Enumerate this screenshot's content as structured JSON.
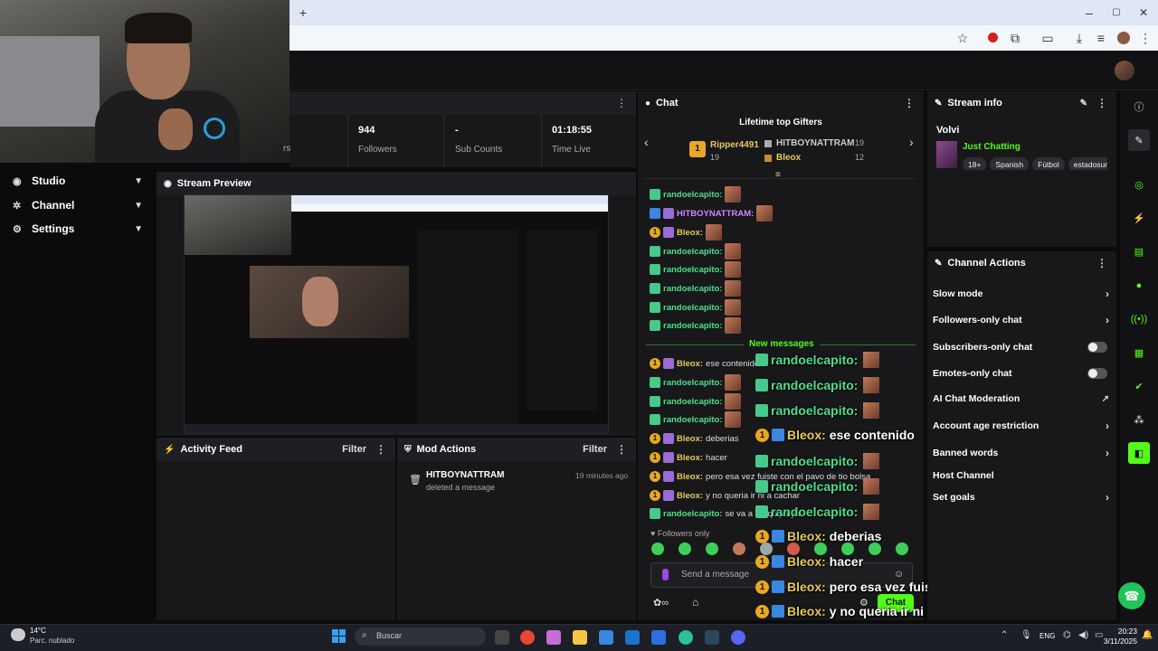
{
  "browser": {
    "new_tab": "+",
    "minimize": "–",
    "restore": "▢",
    "close": "✕"
  },
  "nav": {
    "items": [
      {
        "label": "Studio",
        "icon": "camera-icon"
      },
      {
        "label": "Channel",
        "icon": "gear-icon"
      },
      {
        "label": "Settings",
        "icon": "gear-icon"
      }
    ]
  },
  "stats": [
    {
      "value": "944",
      "label": "Followers"
    },
    {
      "value": "-",
      "label": "Sub Counts"
    },
    {
      "value": "01:18:55",
      "label": "Time Live"
    }
  ],
  "stats_partial_label": "rs",
  "preview": {
    "title": "Stream Preview"
  },
  "activity": {
    "title": "Activity Feed",
    "filter": "Filter"
  },
  "mod_actions": {
    "title": "Mod Actions",
    "filter": "Filter",
    "entries": [
      {
        "user": "HITBOYNATTRAM",
        "action": "deleted a message",
        "time": "19 minutes ago"
      }
    ]
  },
  "chat": {
    "title": "Chat",
    "gifters_title": "Lifetime top Gifters",
    "gifters": [
      {
        "name": "Ripper4491",
        "count": "19",
        "rank": "1"
      },
      {
        "name": "HITBOYNATTRAM",
        "count": "19"
      },
      {
        "name": "Bleox",
        "count": "12"
      }
    ],
    "new_messages": "New messages",
    "followers_only": "Followers only",
    "send_placeholder": "Send a message",
    "chat_button": "Chat",
    "lines": [
      {
        "user": "randoelcapito:",
        "text": "",
        "color": "green",
        "emote": true
      },
      {
        "user": "HITBOYNATTRAM:",
        "text": "",
        "color": "purple",
        "emote": true
      },
      {
        "user": "Bleox:",
        "text": "",
        "color": "gold",
        "emote": true
      },
      {
        "user": "randoelcapito:",
        "text": "",
        "color": "green",
        "emote": true
      },
      {
        "user": "randoelcapito:",
        "text": "",
        "color": "green",
        "emote": true
      },
      {
        "user": "randoelcapito:",
        "text": "",
        "color": "green",
        "emote": true
      },
      {
        "user": "randoelcapito:",
        "text": "",
        "color": "green",
        "emote": true
      },
      {
        "user": "randoelcapito:",
        "text": "",
        "color": "green",
        "emote": true
      },
      {
        "user": "Bleox:",
        "text": "ese contenido",
        "color": "gold",
        "emote": false
      },
      {
        "user": "randoelcapito:",
        "text": "",
        "color": "green",
        "emote": true
      },
      {
        "user": "randoelcapito:",
        "text": "",
        "color": "green",
        "emote": true
      },
      {
        "user": "randoelcapito:",
        "text": "",
        "color": "green",
        "emote": true
      },
      {
        "user": "Bleox:",
        "text": "deberias",
        "color": "gold",
        "emote": false
      },
      {
        "user": "Bleox:",
        "text": "hacer",
        "color": "gold",
        "emote": false
      },
      {
        "user": "Bleox:",
        "text": "pero esa vez fuiste con el pavo de tio bolsa",
        "color": "gold",
        "emote": false
      },
      {
        "user": "Bleox:",
        "text": "y no queria ir ni a cachar",
        "color": "gold",
        "emote": false
      },
      {
        "user": "randoelcapito:",
        "text": "se va a arequipa ya",
        "color": "green",
        "emote": false
      }
    ]
  },
  "overlay": [
    {
      "user": "randoelcapito:",
      "text": "",
      "type": "green",
      "emote": true
    },
    {
      "user": "randoelcapito:",
      "text": "",
      "type": "green",
      "emote": true
    },
    {
      "user": "randoelcapito:",
      "text": "",
      "type": "green",
      "emote": true
    },
    {
      "user": "Bleox:",
      "text": "ese contenido",
      "type": "gold",
      "emote": false
    },
    {
      "user": "randoelcapito:",
      "text": "",
      "type": "green",
      "emote": true
    },
    {
      "user": "randoelcapito:",
      "text": "",
      "type": "green",
      "emote": true
    },
    {
      "user": "randoelcapito:",
      "text": "",
      "type": "green",
      "emote": true
    },
    {
      "user": "Bleox:",
      "text": "deberias",
      "type": "gold",
      "emote": false
    },
    {
      "user": "Bleox:",
      "text": "hacer",
      "type": "gold",
      "emote": false
    },
    {
      "user": "Bleox:",
      "text": "pero esa vez fuiste con el pavo de tio bolsa",
      "type": "gold",
      "emote": false
    },
    {
      "user": "Bleox:",
      "text": "y no queria ir ni a cachar",
      "type": "gold",
      "emote": false
    },
    {
      "user": "randoelcapito:",
      "text": "se va a arequipa ya",
      "type": "green",
      "emote": false
    }
  ],
  "stream_info": {
    "title": "Stream info",
    "stream_title": "Volvi",
    "category": "Just Chatting",
    "tags": [
      "18+",
      "Spanish",
      "Fútbol",
      "estadosun"
    ]
  },
  "channel_actions": {
    "title": "Channel Actions",
    "items": [
      {
        "label": "Slow mode",
        "control": "arrow"
      },
      {
        "label": "Followers-only chat",
        "control": "arrow"
      },
      {
        "label": "Subscribers-only chat",
        "control": "toggle"
      },
      {
        "label": "Emotes-only chat",
        "control": "toggle"
      },
      {
        "label": "AI Chat Moderation",
        "control": "external"
      },
      {
        "label": "Account age restriction",
        "control": "arrow"
      },
      {
        "label": "Banned words",
        "control": "arrow"
      },
      {
        "label": "Host Channel",
        "control": "none"
      },
      {
        "label": "Set goals",
        "control": "arrow"
      }
    ]
  },
  "taskbar": {
    "weather_temp": "14°C",
    "weather_desc": "Parc. nublado",
    "search_placeholder": "Buscar",
    "lang": "ENG",
    "time": "20:23",
    "date": "3/11/2025"
  },
  "colors": {
    "accent": "#53fc18",
    "bg": "#0b0b0c",
    "panel": "#18181b"
  }
}
